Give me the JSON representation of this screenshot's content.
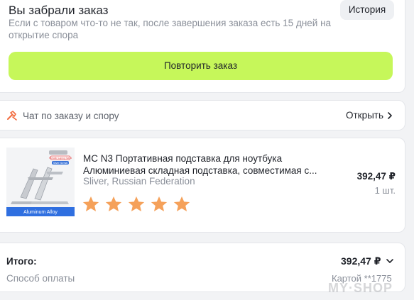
{
  "order": {
    "title": "Вы забрали заказ",
    "description": "Если с товаром что-то не так, после завершения заказа есть 15 дней на открытие спора",
    "history_label": "История",
    "repeat_label": "Повторить заказ"
  },
  "chat": {
    "label": "Чат по заказу и спору",
    "open_label": "Открыть"
  },
  "product": {
    "title_line1": "MC N3 Портативная подставка для ноутбука",
    "title_line2": "Алюминиевая складная подставка, совместимая с...",
    "variant": "Sliver, Russian Federation",
    "price": "392,47 ₽",
    "quantity": "1 шт.",
    "rating": 5,
    "image_badge": "Aluminum Alloy",
    "image_tag1": "Portable Laptop Stand",
    "image_tag2": "Sliver Normal"
  },
  "summary": {
    "total_label": "Итого:",
    "total_value": "392,47 ₽",
    "payment_label": "Способ оплаты",
    "payment_value": "Картой **1775"
  },
  "watermark": "MY·SHOP",
  "colors": {
    "accent_button": "#c6f75a",
    "star": "#f5a15a",
    "chat_icon": "#f26a3d"
  }
}
